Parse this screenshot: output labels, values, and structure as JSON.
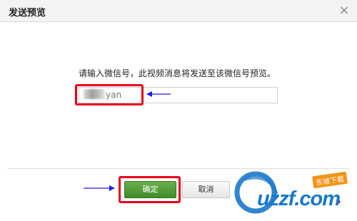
{
  "dialog": {
    "title": "发送预览",
    "close_symbol": "×"
  },
  "form": {
    "prompt": "请输入微信号，此视频消息将发送至该微信号预览。",
    "wechat_value_visible": "yan",
    "wechat_value_obscured": true
  },
  "actions": {
    "confirm_label": "确定",
    "cancel_label": "取消"
  },
  "watermark": {
    "text": "uzzf.com",
    "badge": "东坡下载"
  },
  "colors": {
    "accent_green": "#4c9e35",
    "highlight_red": "#e8001c",
    "arrow_blue": "#1a1aff",
    "watermark_blue": "#1a78c9",
    "watermark_orange": "#f29418"
  }
}
